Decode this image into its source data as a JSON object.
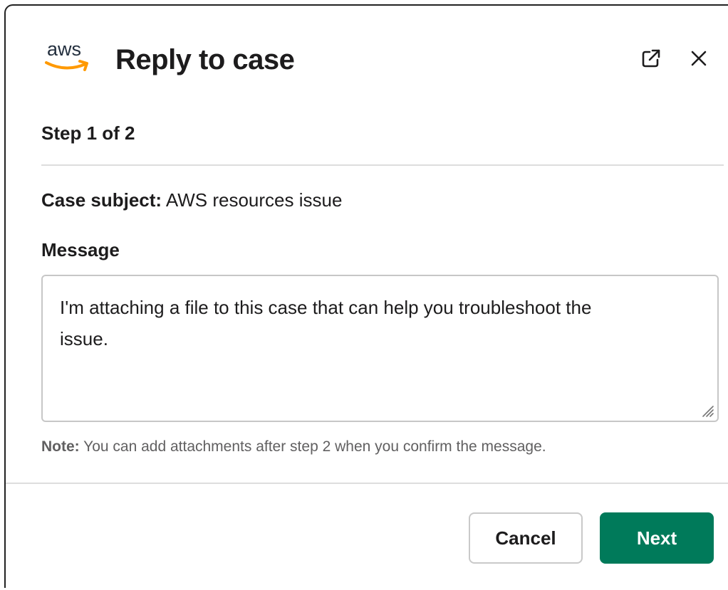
{
  "logo": {
    "text": "aws",
    "icon": "aws-logo"
  },
  "header": {
    "title": "Reply to case",
    "open_icon": "external-link-icon",
    "close_icon": "close-icon"
  },
  "step": "Step 1 of 2",
  "case": {
    "subject_label": "Case subject:",
    "subject_value": "AWS resources issue"
  },
  "message": {
    "label": "Message",
    "value": "I'm attaching a file to this case that can help you troubleshoot the issue."
  },
  "note": {
    "label": "Note:",
    "text": "You can add attachments after step 2 when you confirm the message."
  },
  "buttons": {
    "cancel": "Cancel",
    "next": "Next"
  },
  "colors": {
    "primary": "#007a5a",
    "aws_orange": "#ff9900",
    "aws_navy": "#232f3e"
  }
}
